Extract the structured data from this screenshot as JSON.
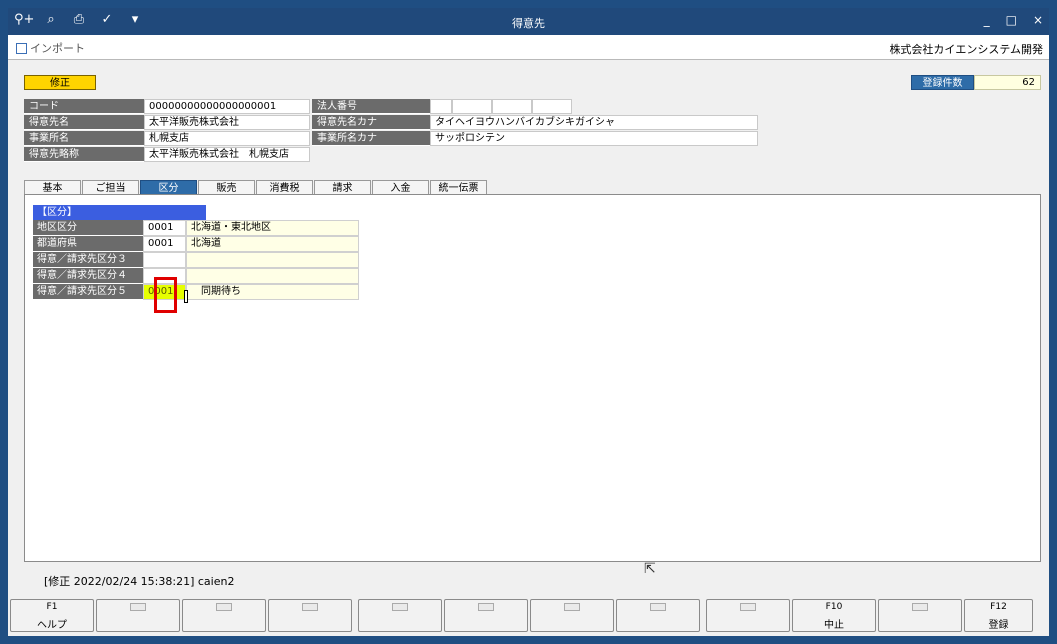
{
  "window": {
    "title": "得意先",
    "controls": [
      "_",
      "□",
      "×"
    ],
    "toolbar_icons": [
      "search-plus-icon",
      "find-icon",
      "print-icon",
      "check-icon",
      "dropdown-icon"
    ]
  },
  "subtoolbar": {
    "import_label": "インポート",
    "company": "株式会社カイエンシステム開発"
  },
  "mode": "修正",
  "record_count": {
    "label": "登録件数",
    "value": "62"
  },
  "header": {
    "code_label": "コード",
    "code_value": "00000000000000000001",
    "corp_no_label": "法人番号",
    "name_label": "得意先名",
    "name_value": "太平洋販売株式会社",
    "name_kana_label": "得意先名カナ",
    "name_kana_value": "タイヘイヨウハンバイカブシキガイシャ",
    "office_label": "事業所名",
    "office_value": "札幌支店",
    "office_kana_label": "事業所名カナ",
    "office_kana_value": "サッポロシテン",
    "short_label": "得意先略称",
    "short_value": "太平洋販売株式会社　札幌支店"
  },
  "tabs": [
    {
      "label": "基本"
    },
    {
      "label": "ご担当"
    },
    {
      "label": "区分",
      "active": true
    },
    {
      "label": "販売"
    },
    {
      "label": "消費税"
    },
    {
      "label": "請求"
    },
    {
      "label": "入金"
    },
    {
      "label": "統一伝票"
    }
  ],
  "section": {
    "title": "【区分】",
    "rows": [
      {
        "label": "地区区分",
        "code": "0001",
        "name": "北海道・東北地区"
      },
      {
        "label": "都道府県",
        "code": "0001",
        "name": "北海道"
      },
      {
        "label": "得意／請求先区分３",
        "code": "",
        "name": ""
      },
      {
        "label": "得意／請求先区分４",
        "code": "",
        "name": ""
      },
      {
        "label": "得意／請求先区分５",
        "code": "0001",
        "name": "同期待ち"
      }
    ]
  },
  "status": "[修正  2022/02/24 15:38:21]  caien2",
  "fkeys": [
    {
      "num": "F1",
      "label": "ヘルプ"
    },
    {
      "num": "",
      "label": ""
    },
    {
      "num": "",
      "label": ""
    },
    {
      "num": "",
      "label": ""
    },
    {
      "num": "",
      "label": ""
    },
    {
      "num": "",
      "label": ""
    },
    {
      "num": "",
      "label": ""
    },
    {
      "num": "",
      "label": ""
    },
    {
      "num": "",
      "label": ""
    },
    {
      "num": "F10",
      "label": "中止"
    },
    {
      "num": "",
      "label": ""
    },
    {
      "num": "F12",
      "label": "登録"
    }
  ]
}
